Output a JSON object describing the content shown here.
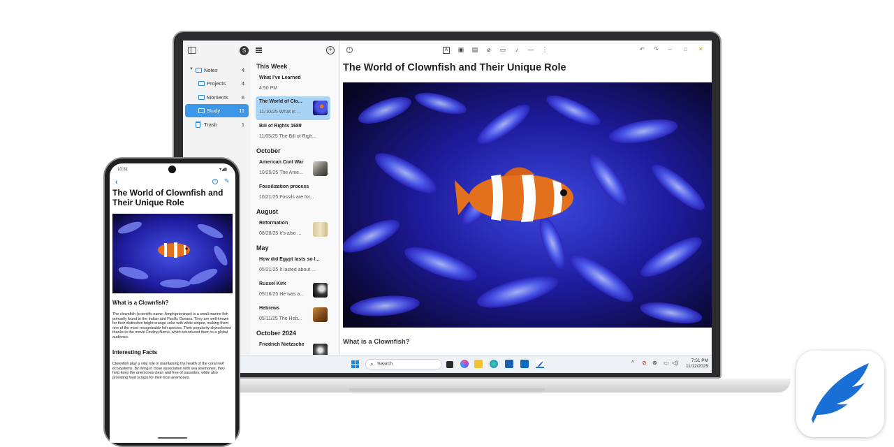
{
  "desktop": {
    "nav": {
      "avatar_initial": "S",
      "items": [
        {
          "label": "Notes",
          "count": "4"
        },
        {
          "label": "Projects",
          "count": "4"
        },
        {
          "label": "Moments",
          "count": "6"
        },
        {
          "label": "Study",
          "count": "11"
        },
        {
          "label": "Trash",
          "count": "1"
        }
      ]
    },
    "list": {
      "sections": [
        "This Week",
        "October",
        "August",
        "May",
        "October 2024"
      ],
      "notes": [
        {
          "title": "What I've Learned",
          "sub": "4:50 PM"
        },
        {
          "title": "The World of Clo...",
          "sub": "11/10/25  What is ..."
        },
        {
          "title": "Bill of Rights 1689",
          "sub": "11/05/25  The Bill of Righ..."
        },
        {
          "title": "American Civil War",
          "sub": "10/25/25  The Ame..."
        },
        {
          "title": "Fossilization process",
          "sub": "10/21/25  Fossils are for..."
        },
        {
          "title": "Reformation",
          "sub": "08/28/25  It's also ..."
        },
        {
          "title": "How did Egypt lasts so l...",
          "sub": "05/21/25  It lasted about ..."
        },
        {
          "title": "Russel Kirk",
          "sub": "05/16/25  He was a..."
        },
        {
          "title": "Hebrews",
          "sub": "05/11/25  The Heb..."
        },
        {
          "title": "Friedrich Nietzsche",
          "sub": ""
        }
      ]
    },
    "editor": {
      "title": "The World of Clownfish and Their Unique Role",
      "heading": "What is a Clownfish?"
    },
    "taskbar": {
      "search_placeholder": "Search",
      "time": "7:51 PM",
      "date": "11/12/2025"
    }
  },
  "phone": {
    "time": "10:31",
    "title": "The World of Clownfish and Their Unique Role",
    "heading1": "What is a Clownfish?",
    "para1": "The clownfish (scientific name: Amphiprioninae) is a small marine fish primarily found in the Indian and Pacific Oceans. They are well-known for their distinctive bright orange color with white stripes, making them one of the most recognizable fish species. Their popularity skyrocketed thanks to the movie Finding Nemo, which introduced them to a global audience.",
    "heading2": "Interesting Facts",
    "para2": "Clownfish play a vital role in maintaining the health of the coral reef ecosystems. By living in close association with sea anemones, they help keep the anemones clean and free of parasites, while also providing food scraps for their host anemones."
  },
  "colors": {
    "accent": "#3d97e8",
    "selected_note": "#a9d3f5",
    "app_icon_blue": "#1a6fd6"
  }
}
